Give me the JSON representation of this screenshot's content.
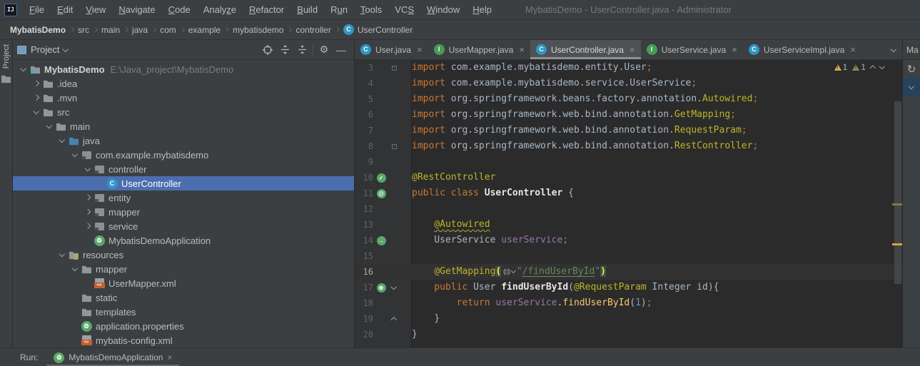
{
  "window": {
    "title": "MybatisDemo - UserController.java - Administrator",
    "logo_text": "IJ"
  },
  "colors": {
    "panel_bg": "#3c3f41",
    "editor_bg": "#2b2b2b",
    "gutter_bg": "#313335",
    "selection_blue": "#4b6eaf",
    "keyword": "#cc7832",
    "annotation": "#bbb529",
    "string": "#6a8759",
    "number": "#6897bb",
    "field": "#9876aa",
    "method_call": "#ffc66b",
    "text": "#a9b7c6",
    "warning_yellow": "#d9a84e",
    "warning_dim": "#8f875f",
    "spring_green": "#59a869",
    "class_icon": "#2f97c5",
    "interface_icon": "#499c54"
  },
  "menu": {
    "items": [
      {
        "label": "File",
        "u": 0
      },
      {
        "label": "Edit",
        "u": 0
      },
      {
        "label": "View",
        "u": 0
      },
      {
        "label": "Navigate",
        "u": 0
      },
      {
        "label": "Code",
        "u": 0
      },
      {
        "label": "Analyze",
        "u": 5
      },
      {
        "label": "Refactor",
        "u": 0
      },
      {
        "label": "Build",
        "u": 0
      },
      {
        "label": "Run",
        "u": 1
      },
      {
        "label": "Tools",
        "u": 0
      },
      {
        "label": "VCS",
        "u": 2
      },
      {
        "label": "Window",
        "u": 0
      },
      {
        "label": "Help",
        "u": 0
      }
    ]
  },
  "breadcrumb": {
    "items": [
      "MybatisDemo",
      "src",
      "main",
      "java",
      "com",
      "example",
      "mybatisdemo",
      "controller"
    ],
    "last": {
      "label": "UserController",
      "icon": "class-icon"
    }
  },
  "project_panel": {
    "strip_label": "Project",
    "header": {
      "title": "Project"
    },
    "tree": [
      {
        "level": 0,
        "chev": "open",
        "icon": "project-folder",
        "label": "MybatisDemo",
        "bold": true,
        "extra": "E:\\Java_project\\MybatisDemo"
      },
      {
        "level": 1,
        "chev": "closed",
        "icon": "folder",
        "label": ".idea"
      },
      {
        "level": 1,
        "chev": "closed",
        "icon": "folder",
        "label": ".mvn"
      },
      {
        "level": 1,
        "chev": "open",
        "icon": "folder",
        "label": "src"
      },
      {
        "level": 2,
        "chev": "open",
        "icon": "folder",
        "label": "main"
      },
      {
        "level": 3,
        "chev": "open",
        "icon": "java-folder",
        "label": "java"
      },
      {
        "level": 4,
        "chev": "open",
        "icon": "package",
        "label": "com.example.mybatisdemo"
      },
      {
        "level": 5,
        "chev": "open",
        "icon": "package",
        "label": "controller"
      },
      {
        "level": 6,
        "chev": null,
        "icon": "class",
        "label": "UserController",
        "selected": true
      },
      {
        "level": 5,
        "chev": "closed",
        "icon": "package",
        "label": "entity"
      },
      {
        "level": 5,
        "chev": "closed",
        "icon": "package",
        "label": "mapper"
      },
      {
        "level": 5,
        "chev": "closed",
        "icon": "package",
        "label": "service"
      },
      {
        "level": 5,
        "chev": null,
        "icon": "spring-boot",
        "label": "MybatisDemoApplication"
      },
      {
        "level": 3,
        "chev": "open",
        "icon": "resources-folder",
        "label": "resources"
      },
      {
        "level": 4,
        "chev": "open",
        "icon": "folder",
        "label": "mapper"
      },
      {
        "level": 5,
        "chev": null,
        "icon": "xml-file",
        "label": "UserMapper.xml"
      },
      {
        "level": 4,
        "chev": null,
        "icon": "folder",
        "label": "static"
      },
      {
        "level": 4,
        "chev": null,
        "icon": "folder",
        "label": "templates"
      },
      {
        "level": 4,
        "chev": null,
        "icon": "spring-properties",
        "label": "application.properties"
      },
      {
        "level": 4,
        "chev": null,
        "icon": "xml-file",
        "label": "mybatis-config.xml"
      }
    ]
  },
  "editor": {
    "tabs": [
      {
        "icon": "class",
        "label": "User.java",
        "active": false
      },
      {
        "icon": "interface",
        "label": "UserMapper.java",
        "active": false
      },
      {
        "icon": "class",
        "label": "UserController.java",
        "active": true
      },
      {
        "icon": "interface",
        "label": "UserService.java",
        "active": false
      },
      {
        "icon": "class",
        "label": "UserServiceImpl.java",
        "active": false
      }
    ],
    "inspections": {
      "warnings_yellow": "1",
      "warnings_dim": "1"
    },
    "code_lines": [
      {
        "n": 3,
        "fold": "box",
        "segs": [
          [
            "kw",
            "import "
          ],
          [
            "pl",
            "com.example.mybatisdemo.entity.User"
          ],
          [
            "kw",
            ";"
          ]
        ]
      },
      {
        "n": 4,
        "fold": "line",
        "segs": [
          [
            "kw",
            "import "
          ],
          [
            "pl",
            "com.example.mybatisdemo.service.UserService"
          ],
          [
            "kw",
            ";"
          ]
        ]
      },
      {
        "n": 5,
        "fold": "line",
        "segs": [
          [
            "kw",
            "import "
          ],
          [
            "pl",
            "org.springframework.beans.factory.annotation."
          ],
          [
            "ann",
            "Autowired"
          ],
          [
            "kw",
            ";"
          ]
        ]
      },
      {
        "n": 6,
        "fold": "line",
        "segs": [
          [
            "kw",
            "import "
          ],
          [
            "pl",
            "org.springframework.web.bind.annotation."
          ],
          [
            "ann",
            "GetMapping"
          ],
          [
            "kw",
            ";"
          ]
        ]
      },
      {
        "n": 7,
        "fold": "line",
        "segs": [
          [
            "kw",
            "import "
          ],
          [
            "pl",
            "org.springframework.web.bind.annotation."
          ],
          [
            "ann",
            "RequestParam"
          ],
          [
            "kw",
            ";"
          ]
        ]
      },
      {
        "n": 8,
        "fold": "box",
        "segs": [
          [
            "kw",
            "import "
          ],
          [
            "pl",
            "org.springframework.web.bind.annotation."
          ],
          [
            "ann",
            "RestController"
          ],
          [
            "kw",
            ";"
          ]
        ]
      },
      {
        "n": 9,
        "fold": "line",
        "segs": []
      },
      {
        "n": 10,
        "fold": "line",
        "gutter": "spring-check",
        "segs": [
          [
            "ann",
            "@RestController"
          ]
        ]
      },
      {
        "n": 11,
        "fold": "line",
        "gutter": "spring-at",
        "segs": [
          [
            "kw",
            "public class "
          ],
          [
            "decl",
            "UserController "
          ],
          [
            "pl",
            "{"
          ]
        ]
      },
      {
        "n": 12,
        "fold": "line",
        "segs": []
      },
      {
        "n": 13,
        "fold": "line",
        "segs": [
          [
            "pl",
            "    "
          ],
          [
            "annW",
            "@Autowired"
          ]
        ]
      },
      {
        "n": 14,
        "fold": "line",
        "gutter": "spring-arrow",
        "segs": [
          [
            "pl",
            "    UserService "
          ],
          [
            "fld",
            "userService"
          ],
          [
            "kw",
            ";"
          ]
        ]
      },
      {
        "n": 15,
        "fold": "line",
        "segs": []
      },
      {
        "n": 16,
        "fold": "line",
        "current": true,
        "segs": [
          [
            "pl",
            "    "
          ],
          [
            "ann",
            "@GetMapping"
          ],
          [
            "brk",
            "("
          ],
          [
            "inlay",
            ""
          ],
          [
            "str",
            "\""
          ],
          [
            "strU",
            "/findUserById"
          ],
          [
            "str",
            "\""
          ],
          [
            "brk",
            ")"
          ]
        ]
      },
      {
        "n": 17,
        "fold": "arrow-down",
        "gutter": "spring-globe",
        "segs": [
          [
            "kw",
            "    public "
          ],
          [
            "pl",
            "User "
          ],
          [
            "decl",
            "findUserById"
          ],
          [
            "pl",
            "("
          ],
          [
            "ann",
            "@RequestParam"
          ],
          [
            "pl",
            " Integer "
          ],
          [
            "pl",
            "id"
          ],
          [
            "pl",
            "){"
          ]
        ]
      },
      {
        "n": 18,
        "fold": "line",
        "segs": [
          [
            "kw",
            "        return "
          ],
          [
            "fld",
            "userService"
          ],
          [
            "pl",
            "."
          ],
          [
            "call",
            "findUserById"
          ],
          [
            "pl",
            "("
          ],
          [
            "num",
            "1"
          ],
          [
            "pl",
            ")"
          ],
          [
            "kw",
            ";"
          ]
        ]
      },
      {
        "n": 19,
        "fold": "arrow-up",
        "segs": [
          [
            "pl",
            "    }"
          ]
        ]
      },
      {
        "n": 20,
        "fold": null,
        "segs": [
          [
            "pl",
            "}"
          ]
        ]
      }
    ]
  },
  "right_panel": {
    "tab_label": "Ma"
  },
  "run_bar": {
    "label": "Run:",
    "tab_label": "MybatisDemoApplication",
    "close_glyph": "×"
  }
}
